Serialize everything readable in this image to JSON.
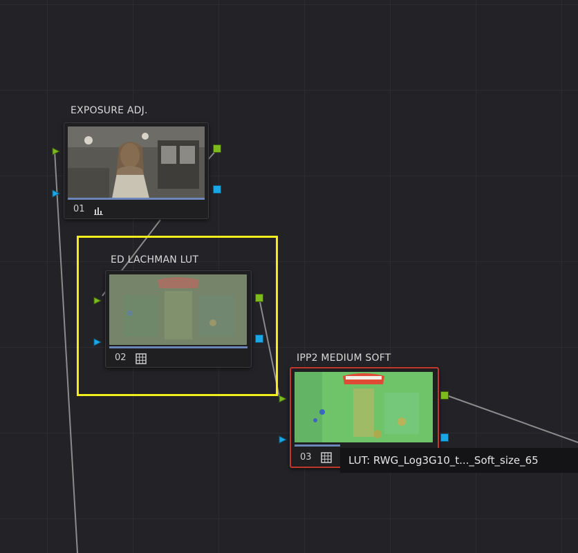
{
  "nodes": [
    {
      "title": "EXPOSURE ADJ.",
      "number": "01",
      "icon": "bar-chart-icon"
    },
    {
      "title": "ED LACHMAN LUT",
      "number": "02",
      "icon": "lut-grid-icon"
    },
    {
      "title": "IPP2  MEDIUM SOFT",
      "number": "03",
      "icon": "lut-grid-icon"
    }
  ],
  "tooltip": {
    "text": "LUT: RWG_Log3G10_t..._Soft_size_65"
  },
  "colors": {
    "rgb_port": "#7dba1e",
    "alpha_port": "#19a7e6",
    "selected_border": "#c0392b",
    "highlight": "#f2ee1a",
    "background": "#232327"
  }
}
